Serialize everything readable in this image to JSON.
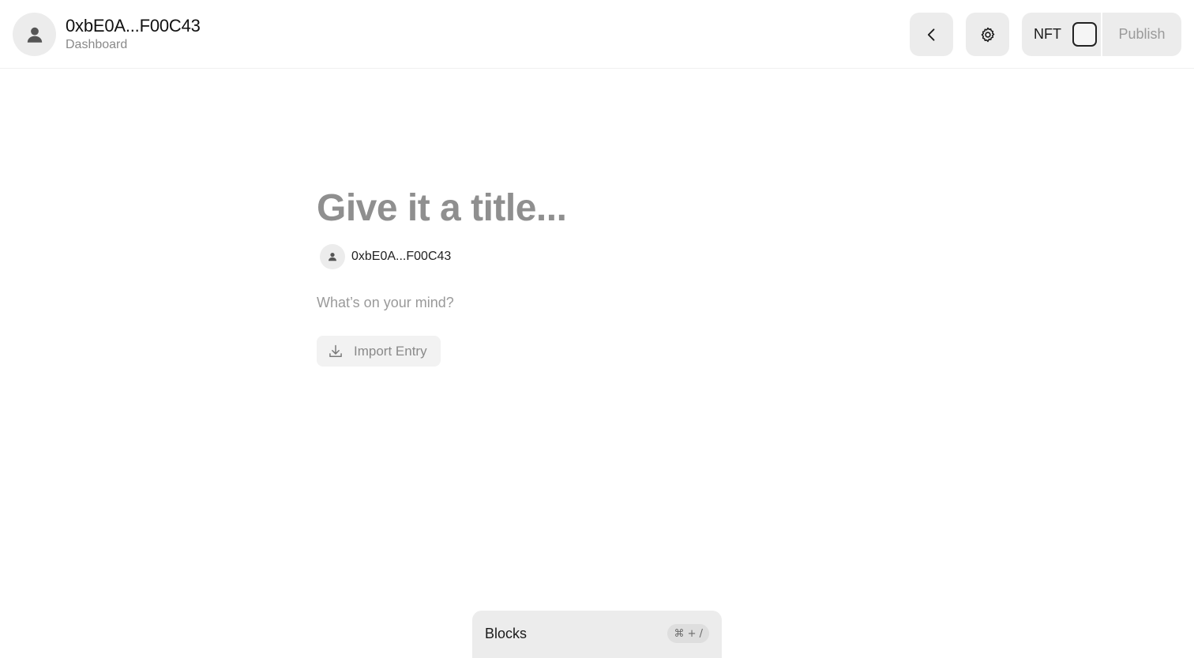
{
  "header": {
    "account_name": "0xbE0A...F00C43",
    "account_subtitle": "Dashboard",
    "back_icon": "chevron-left-icon",
    "settings_icon": "gear-icon",
    "nft_label": "NFT",
    "nft_enabled": false,
    "publish_label": "Publish"
  },
  "editor": {
    "title_placeholder": "Give it a title...",
    "title_value": "",
    "author_name": "0xbE0A...F00C43",
    "body_placeholder": "What’s on your mind?",
    "body_value": "",
    "import_label": "Import Entry",
    "import_icon": "download-icon"
  },
  "blocks": {
    "label": "Blocks",
    "shortcut": "⌘ + /"
  },
  "colors": {
    "surface": "#ececec",
    "muted_text": "#8a8a8a"
  }
}
